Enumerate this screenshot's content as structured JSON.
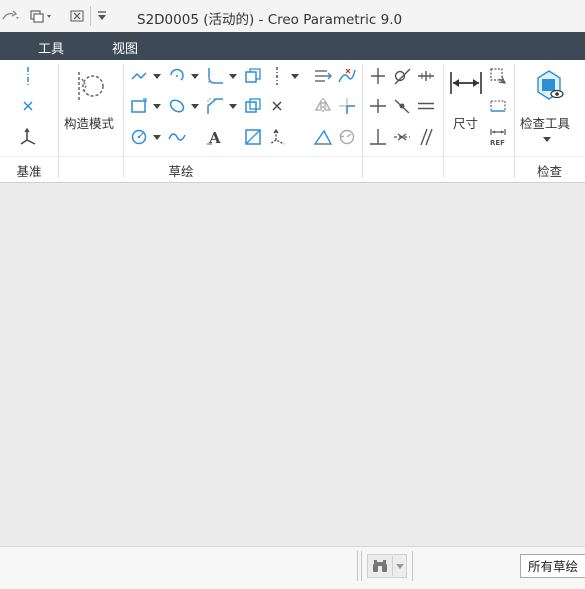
{
  "window": {
    "title": "S2D0005 (活动的) - Creo Parametric 9.0"
  },
  "quick_access": {
    "icons": [
      "redo-icon",
      "window-icon",
      "close-window-icon",
      "customize-icon"
    ]
  },
  "menu": {
    "items": [
      "工具",
      "视图"
    ]
  },
  "ribbon": {
    "groups": {
      "datum": {
        "label": "基准"
      },
      "sketch": {
        "label": "草绘"
      },
      "inspect": {
        "label": "检查"
      }
    },
    "buttons": {
      "construction_mode": "构造模式",
      "dimension": "尺寸",
      "inspect_tools": "检查工具"
    }
  },
  "status": {
    "filter": "所有草绘"
  },
  "colors": {
    "accent_blue": "#2a8fd6",
    "menubar": "#3d4a55",
    "icon_gray": "#555555"
  }
}
